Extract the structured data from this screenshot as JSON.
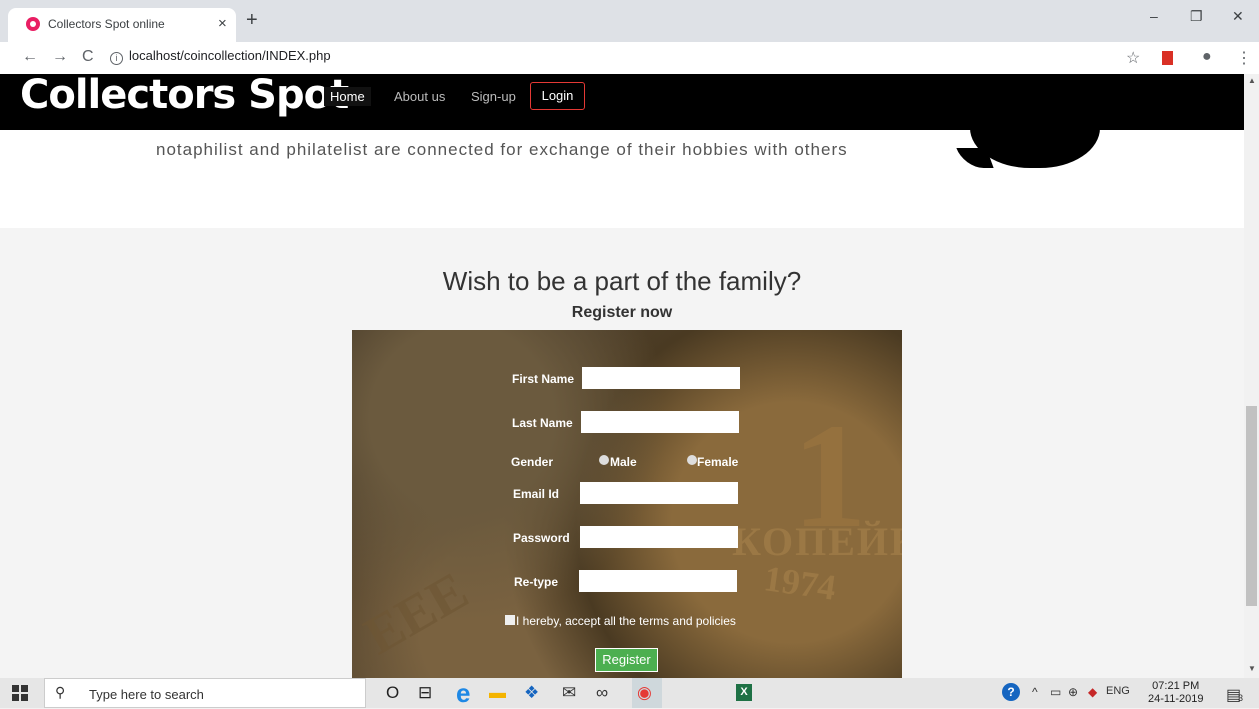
{
  "browser": {
    "tab_title": "Collectors Spot online",
    "tab_close": "×",
    "new_tab": "+",
    "url": "localhost/coincollection/INDEX.php",
    "win_min": "–",
    "win_restore": "❐",
    "win_close": "✕",
    "back": "←",
    "forward": "→",
    "reload": "C",
    "info": "i",
    "star": "☆",
    "bookmark_color": "#d93025",
    "profile": "●",
    "more": "⋮"
  },
  "header": {
    "logo": "Collectors Spot",
    "nav": [
      "Home",
      "About us",
      "Sign-up"
    ],
    "login": "Login"
  },
  "about": {
    "text": "notaphilist and philatelist are connected for exchange of their hobbies with others"
  },
  "register": {
    "heading": "Wish to be a part of the family?",
    "subheading": "Register now",
    "coin_one": "1",
    "coin_word": "КОПЕЙК",
    "coin_year": "1974",
    "coin_left": "EEE",
    "first_name": "First Name",
    "last_name": "Last Name",
    "gender": "Gender",
    "male": "Male",
    "female": "Female",
    "email": "Email Id",
    "password": "Password",
    "retype": "Re-type",
    "terms": "I hereby, accept all the terms and policies",
    "button": "Register"
  },
  "scroll": {
    "up": "▲",
    "down": "▼"
  },
  "taskbar": {
    "search_icon": "⚲",
    "search_placeholder": "Type here to search",
    "cortana": "O",
    "taskview": "⊟",
    "edge": "e",
    "files": "▬",
    "dropbox": "❖",
    "mail": "✉",
    "infinity": "∞",
    "chrome": "◉",
    "excel": "X",
    "help": "?",
    "chevron": "^",
    "battery": "▭",
    "network": "⊕",
    "sync": "◆",
    "lang": "ENG",
    "time": "07:21 PM",
    "date": "24-11-2019",
    "notif": "▤",
    "notif_count": "3"
  }
}
